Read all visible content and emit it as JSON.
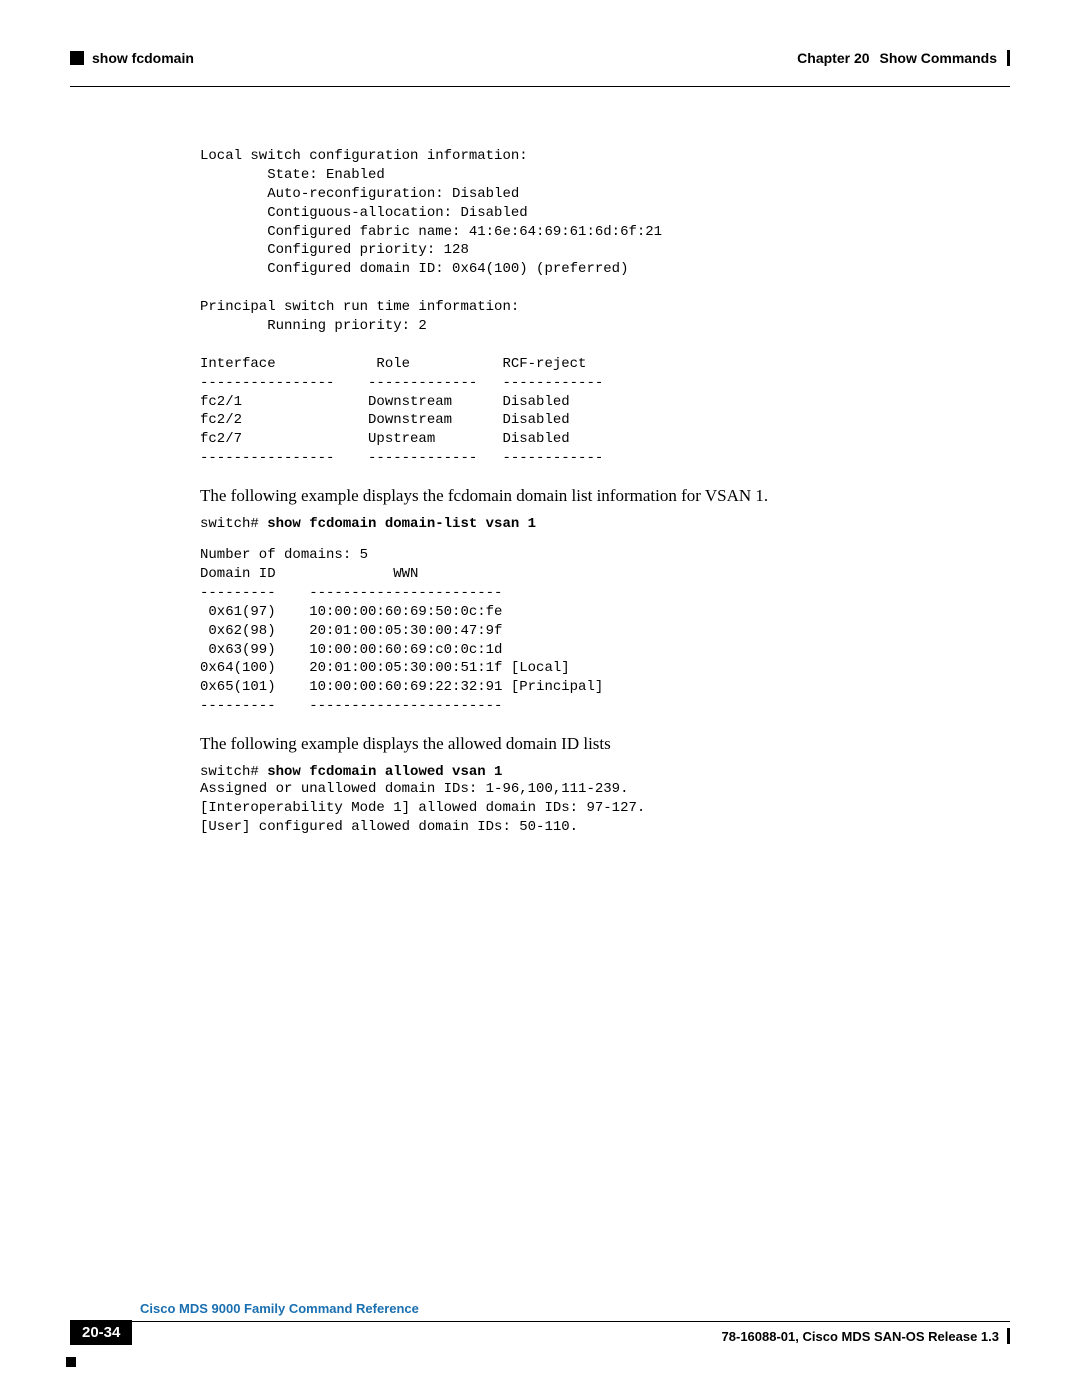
{
  "header": {
    "left_label": "show fcdomain",
    "chapter_label": "Chapter 20",
    "chapter_title": "Show Commands"
  },
  "block1": "Local switch configuration information:\n        State: Enabled\n        Auto-reconfiguration: Disabled\n        Contiguous-allocation: Disabled\n        Configured fabric name: 41:6e:64:69:61:6d:6f:21\n        Configured priority: 128\n        Configured domain ID: 0x64(100) (preferred)\n\nPrincipal switch run time information:\n        Running priority: 2\n\nInterface            Role           RCF-reject\n----------------    -------------   ------------\nfc2/1               Downstream      Disabled\nfc2/2               Downstream      Disabled\nfc2/7               Upstream        Disabled\n----------------    -------------   ------------",
  "para1": "The following example displays the fcdomain domain list information for VSAN 1.",
  "cmd1_prompt": "switch# ",
  "cmd1_bold": "show fcdomain domain-list vsan 1",
  "block2": "Number of domains: 5\nDomain ID              WWN\n---------    -----------------------\n 0x61(97)    10:00:00:60:69:50:0c:fe\n 0x62(98)    20:01:00:05:30:00:47:9f\n 0x63(99)    10:00:00:60:69:c0:0c:1d\n0x64(100)    20:01:00:05:30:00:51:1f [Local]\n0x65(101)    10:00:00:60:69:22:32:91 [Principal]\n---------    -----------------------",
  "para2": "The following example displays the allowed domain ID lists",
  "cmd2_prompt": "switch# ",
  "cmd2_bold": "show fcdomain allowed vsan 1",
  "block3": "Assigned or unallowed domain IDs: 1-96,100,111-239.\n[Interoperability Mode 1] allowed domain IDs: 97-127.\n[User] configured allowed domain IDs: 50-110.",
  "footer": {
    "title": "Cisco MDS 9000 Family Command Reference",
    "page_num": "20-34",
    "release": "78-16088-01, Cisco MDS SAN-OS Release 1.3"
  }
}
